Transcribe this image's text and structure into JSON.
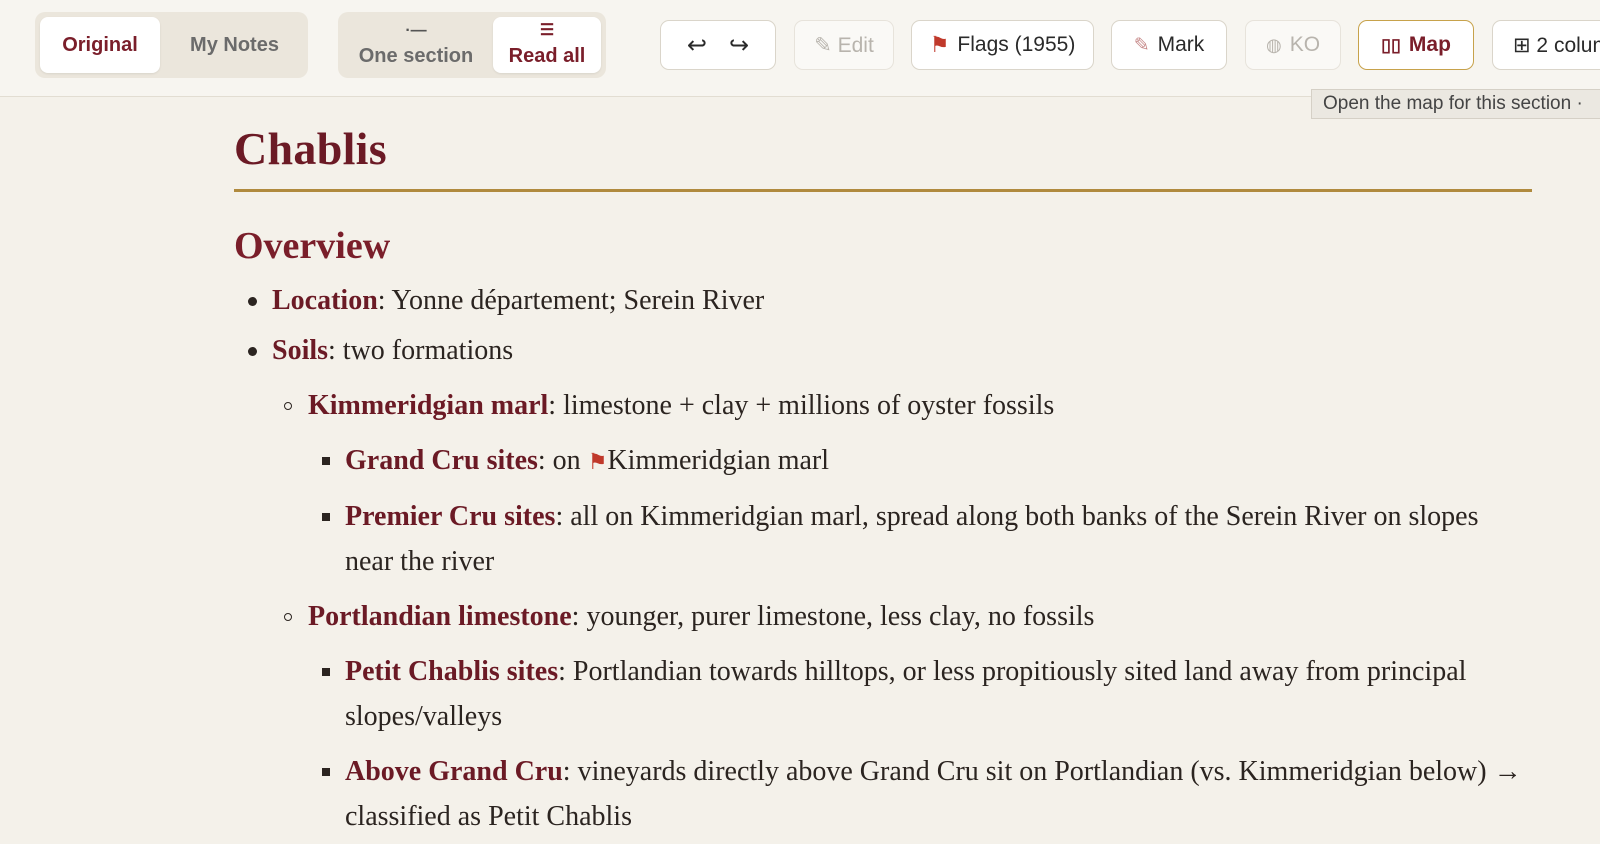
{
  "toolbar": {
    "view_tabs": [
      "Original",
      "My Notes"
    ],
    "mode_tabs": [
      {
        "label": "One section",
        "icon": "section-icon"
      },
      {
        "label": "Read all",
        "icon": "list-icon"
      }
    ],
    "undo_icon": "undo-icon",
    "redo_icon": "redo-icon",
    "edit_label": "✎ Edit",
    "flags_label": "Flags (1955)",
    "mark_label": "Mark",
    "ko_label": "KO",
    "map_label": "Map",
    "columns_label": "⊞ 2 colum",
    "tooltip": "Open the map for this section ·",
    "colors": {
      "accent": "#7a1e2a",
      "gold": "#b08a3e",
      "flag": "#c0392b"
    }
  },
  "document": {
    "title": "Chablis",
    "section": "Overview",
    "items": [
      {
        "term": "Location",
        "text": ": Yonne département; Serein River"
      },
      {
        "term": "Soils",
        "text": ": two formations"
      },
      {
        "term": "Kimmeridgian marl",
        "text": ": limestone + clay + millions of oyster fossils"
      },
      {
        "term": "Grand Cru sites",
        "text_before_flag": ": on ",
        "text_after_flag": "Kimmeridgian marl"
      },
      {
        "term": "Premier Cru sites",
        "text": ": all on Kimmeridgian marl, spread along both banks of the Serein River on slopes near the river"
      },
      {
        "term": "Portlandian limestone",
        "text": ": younger, purer limestone, less clay, no fossils"
      },
      {
        "term": "Petit Chablis sites",
        "text": ": Portlandian towards hilltops, or less propitiously sited land away from principal slopes/valleys"
      },
      {
        "term": "Above Grand Cru",
        "text": ": vineyards directly above Grand Cru sit on Portlandian (vs. Kimmeridgian below) → classified as Petit Chablis"
      }
    ]
  }
}
